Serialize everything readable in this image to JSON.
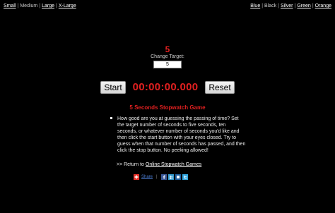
{
  "size_options": [
    "Small",
    "Medium",
    "Large",
    "X-Large"
  ],
  "size_current": "Medium",
  "color_options": [
    "Blue",
    "Black",
    "Silver",
    "Green",
    "Orange"
  ],
  "color_current": "Black",
  "target": {
    "display": "5",
    "label": "Change Target:",
    "value": "5"
  },
  "controls": {
    "start_label": "Start",
    "timer": "00:00:00.000",
    "reset_label": "Reset"
  },
  "game_title": "5 Seconds Stopwatch Game",
  "description": "How good are you at guessing the passing of time? Set the target number of seconds to five seconds, ten seconds, or whatever number of seconds you'd like and then click the start button with your eyes closed. Try to guess when that number of seconds has passed, and then click the stop button. No peeking allowed!",
  "return_prefix": ">> Return to",
  "return_link": "Online Stopwatch Games",
  "share": {
    "label": "Share",
    "icons": [
      "share-plus-icon",
      "facebook-icon",
      "myspace-icon",
      "digg-icon",
      "twitter-icon"
    ],
    "colors": {
      "plus": "#e8322a",
      "facebook": "#3b5998",
      "myspace": "#3399cc",
      "digg": "#1e5e9e",
      "twitter": "#33a7e0"
    }
  },
  "accent_color": "#e02020"
}
